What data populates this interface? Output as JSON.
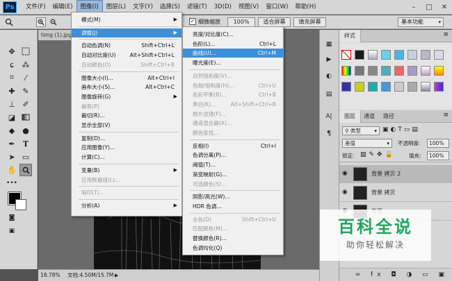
{
  "app": {
    "logo": "Ps",
    "menus": [
      "文件(F)",
      "编辑(E)",
      "图像(I)",
      "图层(L)",
      "文字(Y)",
      "选择(S)",
      "滤镜(T)",
      "3D(D)",
      "视图(V)",
      "窗口(W)",
      "帮助(H)"
    ],
    "active_menu_index": 2,
    "window_controls": [
      "–",
      "□",
      "✕"
    ]
  },
  "options_bar": {
    "tool_glyph": "🔍",
    "fine_zoom_label": "细微缩放",
    "zoom_value": "100%",
    "fit_screen": "适合屏幕",
    "fill_screen": "填充屏幕",
    "workspace": "基本功能"
  },
  "document": {
    "tab_name": "timg (1).jpg",
    "zoom": "18.78%",
    "doc_info": "文档:4.50M/15.7M"
  },
  "image_menu": {
    "items": [
      {
        "label": "模式(M)",
        "shortcut": "",
        "submenu": true,
        "disabled": false
      },
      {
        "sep": true
      },
      {
        "label": "调整(J)",
        "shortcut": "",
        "submenu": true,
        "disabled": false,
        "highlighted": true
      },
      {
        "sep": true
      },
      {
        "label": "自动色调(N)",
        "shortcut": "Shift+Ctrl+L",
        "submenu": false,
        "disabled": false
      },
      {
        "label": "自动对比度(U)",
        "shortcut": "Alt+Shift+Ctrl+L",
        "submenu": false,
        "disabled": false
      },
      {
        "label": "自动颜色(O)",
        "shortcut": "Shift+Ctrl+B",
        "submenu": false,
        "disabled": true
      },
      {
        "sep": true
      },
      {
        "label": "图像大小(I)...",
        "shortcut": "Alt+Ctrl+I",
        "submenu": false,
        "disabled": false
      },
      {
        "label": "画布大小(S)...",
        "shortcut": "Alt+Ctrl+C",
        "submenu": false,
        "disabled": false
      },
      {
        "label": "图像旋转(G)",
        "shortcut": "",
        "submenu": true,
        "disabled": false
      },
      {
        "label": "裁剪(P)",
        "shortcut": "",
        "submenu": false,
        "disabled": true
      },
      {
        "label": "裁切(R)...",
        "shortcut": "",
        "submenu": false,
        "disabled": false
      },
      {
        "label": "显示全部(V)",
        "shortcut": "",
        "submenu": false,
        "disabled": false
      },
      {
        "sep": true
      },
      {
        "label": "复制(D)...",
        "shortcut": "",
        "submenu": false,
        "disabled": false
      },
      {
        "label": "应用图像(Y)...",
        "shortcut": "",
        "submenu": false,
        "disabled": false
      },
      {
        "label": "计算(C)...",
        "shortcut": "",
        "submenu": false,
        "disabled": false
      },
      {
        "sep": true
      },
      {
        "label": "变量(B)",
        "shortcut": "",
        "submenu": true,
        "disabled": false
      },
      {
        "label": "应用数据组(L)...",
        "shortcut": "",
        "submenu": false,
        "disabled": true
      },
      {
        "sep": true
      },
      {
        "label": "陷印(T)...",
        "shortcut": "",
        "submenu": false,
        "disabled": true
      },
      {
        "sep": true
      },
      {
        "label": "分析(A)",
        "shortcut": "",
        "submenu": true,
        "disabled": false
      }
    ]
  },
  "adjust_menu": {
    "items": [
      {
        "label": "亮度/对比度(C)...",
        "shortcut": "",
        "disabled": false
      },
      {
        "label": "色阶(L)...",
        "shortcut": "Ctrl+L",
        "disabled": false
      },
      {
        "label": "曲线(U)...",
        "shortcut": "Ctrl+M",
        "disabled": false,
        "highlighted": true
      },
      {
        "label": "曝光度(E)...",
        "shortcut": "",
        "disabled": false
      },
      {
        "sep": true
      },
      {
        "label": "自然饱和度(V)...",
        "shortcut": "",
        "disabled": true
      },
      {
        "label": "色相/饱和度(H)...",
        "shortcut": "Ctrl+U",
        "disabled": true
      },
      {
        "label": "色彩平衡(B)...",
        "shortcut": "Ctrl+B",
        "disabled": true
      },
      {
        "label": "黑白(K)...",
        "shortcut": "Alt+Shift+Ctrl+B",
        "disabled": true
      },
      {
        "label": "照片滤镜(F)...",
        "shortcut": "",
        "disabled": true
      },
      {
        "label": "通道混合器(X)...",
        "shortcut": "",
        "disabled": true
      },
      {
        "label": "颜色查找...",
        "shortcut": "",
        "disabled": true
      },
      {
        "sep": true
      },
      {
        "label": "反相(I)",
        "shortcut": "Ctrl+I",
        "disabled": false
      },
      {
        "label": "色调分离(P)...",
        "shortcut": "",
        "disabled": false
      },
      {
        "label": "阈值(T)...",
        "shortcut": "",
        "disabled": false
      },
      {
        "label": "渐变映射(G)...",
        "shortcut": "",
        "disabled": false
      },
      {
        "label": "可选颜色(S)...",
        "shortcut": "",
        "disabled": true
      },
      {
        "sep": true
      },
      {
        "label": "阴影/高光(W)...",
        "shortcut": "",
        "disabled": false
      },
      {
        "label": "HDR 色调...",
        "shortcut": "",
        "disabled": false
      },
      {
        "sep": true
      },
      {
        "label": "去色(D)",
        "shortcut": "Shift+Ctrl+U",
        "disabled": true
      },
      {
        "label": "匹配颜色(M)...",
        "shortcut": "",
        "disabled": true
      },
      {
        "label": "替换颜色(R)...",
        "shortcut": "",
        "disabled": false
      },
      {
        "label": "色调均化(Q)",
        "shortcut": "",
        "disabled": false
      }
    ]
  },
  "styles_panel": {
    "tab": "样式"
  },
  "layers_panel": {
    "tabs": [
      "图层",
      "通道",
      "路径"
    ],
    "kind_filter": "类型",
    "blend_mode": "差值",
    "opacity_label": "不透明度:",
    "opacity_value": "100%",
    "lock_label": "锁定:",
    "fill_label": "填充:",
    "fill_value": "100%",
    "layers": [
      {
        "name": "背景 拷贝 2",
        "selected": true
      },
      {
        "name": "背景 拷贝",
        "selected": false
      },
      {
        "name": "背景",
        "selected": false
      }
    ]
  },
  "panel_side_labels": [
    "A|",
    "¶"
  ],
  "watermark": {
    "title": "百科全说",
    "subtitle": "助你轻松解决"
  },
  "colors": {
    "accent": "#3d8fd8",
    "watermark_green": "#1fa65c"
  }
}
